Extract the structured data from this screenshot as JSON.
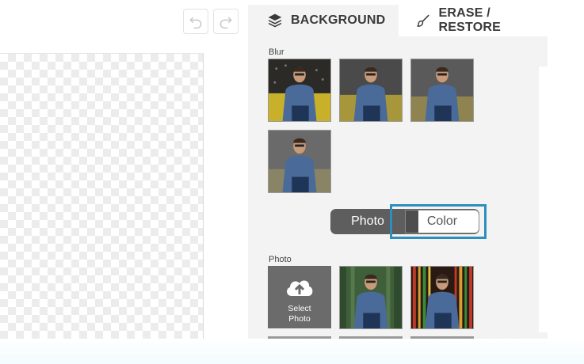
{
  "toolbar": {
    "undo_icon": "undo-icon",
    "redo_icon": "redo-icon"
  },
  "tabs": [
    {
      "label": "BACKGROUND",
      "icon": "layers-icon",
      "active": true
    },
    {
      "label": "ERASE / RESTORE",
      "icon": "brush-icon",
      "active": false
    }
  ],
  "blur_section": {
    "label": "Blur",
    "thumbnails": [
      "blur-none",
      "blur-light",
      "blur-medium",
      "blur-heavy"
    ]
  },
  "mode_toggle": {
    "photo_label": "Photo",
    "color_label": "Color",
    "selected": "Photo"
  },
  "photo_section": {
    "label": "Photo",
    "upload_line1": "Select",
    "upload_line2": "Photo",
    "upload_icon": "cloud-upload-icon",
    "thumbnails": [
      "forest-road",
      "colored-stripes"
    ]
  },
  "colors": {
    "accent_highlight": "#2e8ec0",
    "toggle_dark": "#5e5e5e",
    "panel_bg": "#f3f3f3"
  }
}
